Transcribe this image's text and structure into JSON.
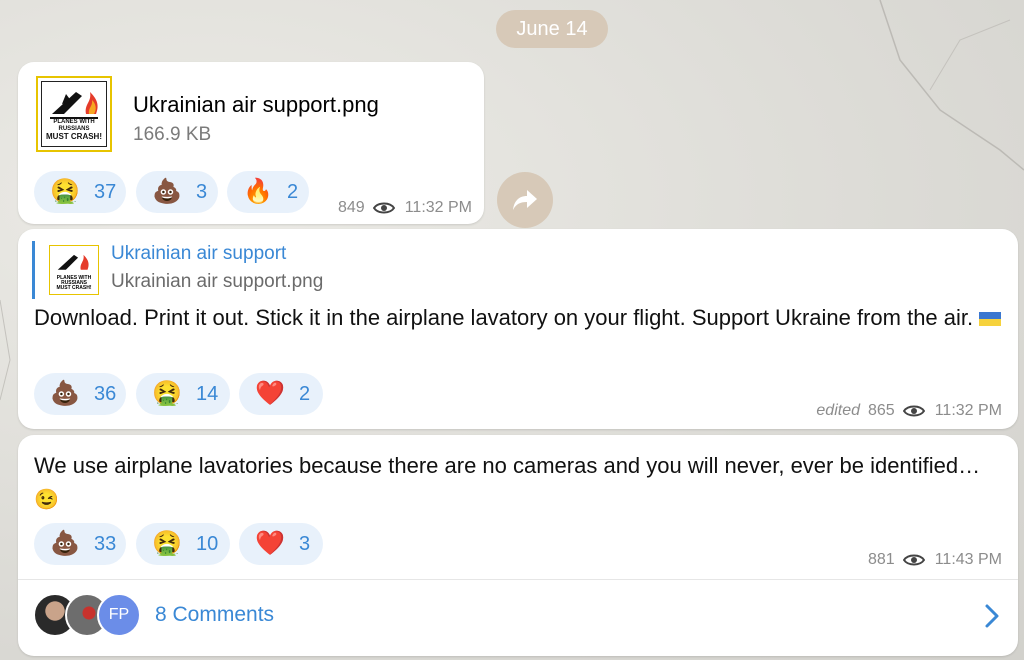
{
  "date_pill": "June 14",
  "file_message": {
    "file_name": "Ukrainian air support.png",
    "file_size": "166.9 KB",
    "thumb_caption_small": "PLANES WITH RUSSIANS",
    "thumb_caption_big": "MUST CRASH!",
    "reactions": [
      {
        "emoji": "🤮",
        "icon": "vomit-face-icon",
        "count": "37"
      },
      {
        "emoji": "💩",
        "icon": "poop-icon",
        "count": "3"
      },
      {
        "emoji": "🔥",
        "icon": "fire-icon",
        "count": "2"
      }
    ],
    "views": "849",
    "time": "11:32 PM"
  },
  "text_message_1": {
    "reply_title": "Ukrainian air support",
    "reply_subtitle": "Ukrainian air support.png",
    "text": "Download. Print it out. Stick it in the airplane lavatory on your flight. Support Ukraine from the air.",
    "reactions": [
      {
        "emoji": "💩",
        "icon": "poop-icon",
        "count": "36"
      },
      {
        "emoji": "🤮",
        "icon": "vomit-face-icon",
        "count": "14"
      },
      {
        "emoji": "❤️",
        "icon": "heart-icon",
        "count": "2"
      }
    ],
    "edited_label": "edited",
    "views": "865",
    "time": "11:32 PM"
  },
  "text_message_2": {
    "text": "We use airplane lavatories because there are no cameras and you will never, ever be identified…",
    "trailing_emoji": "😉",
    "reactions": [
      {
        "emoji": "💩",
        "icon": "poop-icon",
        "count": "33"
      },
      {
        "emoji": "🤮",
        "icon": "vomit-face-icon",
        "count": "10"
      },
      {
        "emoji": "❤️",
        "icon": "heart-icon",
        "count": "3"
      }
    ],
    "views": "881",
    "time": "11:43 PM",
    "comments_label": "8 Comments",
    "avatar_initials": "FP"
  },
  "colors": {
    "accent": "#3a88d5",
    "reaction_bg": "#e8f1fb",
    "date_pill_bg": "#d7c9b8"
  }
}
